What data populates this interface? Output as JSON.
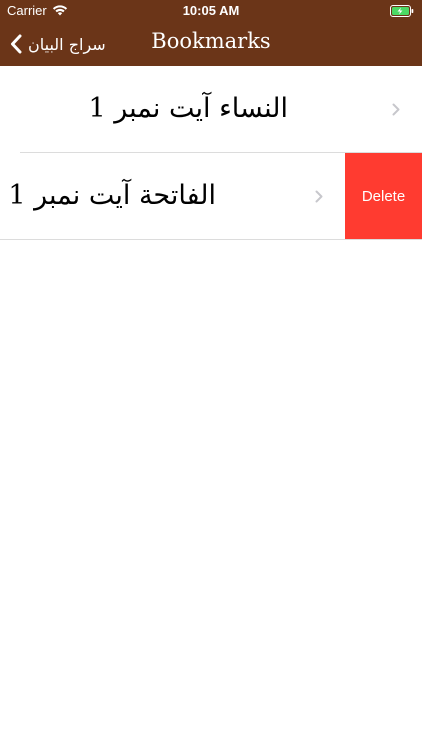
{
  "status_bar": {
    "carrier": "Carrier",
    "time": "10:05 AM",
    "wifi_icon": "wifi-icon",
    "battery_icon": "battery-charging-icon"
  },
  "nav": {
    "back_label": "سراج البیان",
    "back_icon": "chevron-left-icon",
    "title": "Bookmarks"
  },
  "bookmarks": [
    {
      "label": "النساء آیت نمبر 1"
    },
    {
      "label": "الفاتحة آیت نمبر 1",
      "swipe_action": "Delete"
    }
  ],
  "colors": {
    "nav_background": "#6b3518",
    "delete_action": "#ff3b30",
    "separator": "#dcdcdc",
    "disclosure": "#c7c7cc"
  }
}
